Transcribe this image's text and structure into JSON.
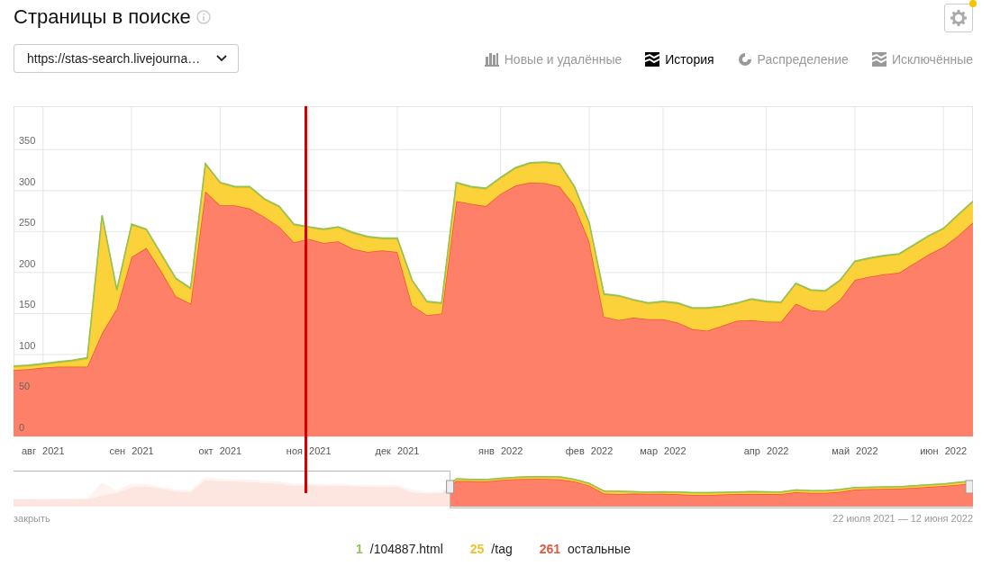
{
  "title": "Страницы в поиске",
  "url_select": {
    "value": "https://stas-search.livejourna…"
  },
  "tabs": [
    {
      "label": "Новые и удалённые",
      "selected": false
    },
    {
      "label": "История",
      "selected": true
    },
    {
      "label": "Распределение",
      "selected": false
    },
    {
      "label": "Исключённые",
      "selected": false
    }
  ],
  "settings": {
    "notification": true
  },
  "chart": {
    "chart_data": {
      "type": "area",
      "stacked": true,
      "grid": true,
      "categories": [
        null,
        null,
        "авг 2021",
        null,
        null,
        null,
        null,
        null,
        "сен 2021",
        null,
        null,
        null,
        null,
        null,
        "окт 2021",
        null,
        null,
        null,
        null,
        null,
        "ноя 2021",
        null,
        null,
        null,
        null,
        null,
        "дек 2021",
        null,
        null,
        null,
        null,
        null,
        null,
        "янв 2022",
        null,
        null,
        null,
        null,
        null,
        "фев 2022",
        null,
        null,
        null,
        null,
        "мар 2022",
        null,
        null,
        null,
        null,
        null,
        null,
        "апр 2022",
        null,
        null,
        null,
        null,
        null,
        "май 2022",
        null,
        null,
        null,
        null,
        null,
        "июн 2022",
        null,
        null
      ],
      "ylim": [
        0,
        403
      ],
      "yticks": [
        0,
        50,
        100,
        150,
        200,
        250,
        300,
        350
      ],
      "series": [
        {
          "name": "остальные",
          "color": "#ff8068",
          "values": [
            81,
            82,
            84,
            85,
            85,
            85,
            126,
            156,
            219,
            230,
            202,
            171,
            162,
            299,
            282,
            282,
            278,
            268,
            256,
            237,
            241,
            236,
            238,
            229,
            225,
            227,
            225,
            160,
            148,
            150,
            287,
            284,
            281,
            296,
            306,
            310,
            309,
            305,
            282,
            238,
            146,
            142,
            145,
            143,
            143,
            139,
            131,
            129,
            135,
            141,
            142,
            140,
            140,
            162,
            154,
            153,
            167,
            191,
            195,
            198,
            200,
            211,
            222,
            231,
            245,
            261
          ]
        },
        {
          "name": "/tag",
          "color": "#fcd23a",
          "values": [
            4,
            4,
            4,
            5,
            7,
            10,
            143,
            22,
            39,
            22,
            20,
            21,
            18,
            33,
            27,
            22,
            26,
            21,
            24,
            21,
            14,
            16,
            17,
            19,
            18,
            14,
            16,
            30,
            16,
            12,
            22,
            20,
            21,
            19,
            21,
            23,
            25,
            27,
            22,
            22,
            27,
            29,
            21,
            19,
            21,
            23,
            25,
            27,
            23,
            21,
            25,
            24,
            23,
            24,
            24,
            24,
            23,
            22,
            22,
            22,
            22,
            22,
            22,
            22,
            25,
            25
          ]
        },
        {
          "name": "/104887.html",
          "color": "#8fc45a",
          "values": [
            1,
            1,
            1,
            1,
            1,
            1,
            1,
            1,
            1,
            1,
            1,
            1,
            1,
            1,
            1,
            1,
            1,
            1,
            1,
            1,
            1,
            1,
            1,
            1,
            1,
            1,
            1,
            1,
            1,
            1,
            1,
            1,
            1,
            1,
            1,
            1,
            1,
            1,
            1,
            1,
            1,
            1,
            1,
            1,
            1,
            1,
            1,
            1,
            1,
            1,
            1,
            1,
            1,
            1,
            1,
            1,
            1,
            1,
            1,
            1,
            1,
            1,
            1,
            1,
            1,
            1
          ]
        }
      ]
    }
  },
  "navigator": {
    "level": 0.455,
    "close_label": "закрыть",
    "range": "22 июля 2021 — 12 июня 2022"
  },
  "legend": [
    {
      "count": "1",
      "color": "#8fc45a"
    },
    {
      "count": "25",
      "color": "#f0c030"
    },
    {
      "count": "261",
      "color": "#e05a40"
    }
  ]
}
